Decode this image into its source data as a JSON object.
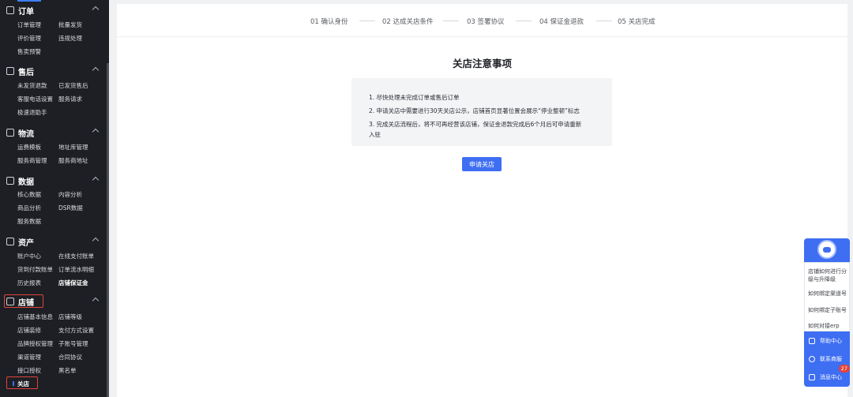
{
  "sidebar": {
    "groups": [
      {
        "title": "订单",
        "icon": "order-icon",
        "items": [
          "订单管理",
          "批量发货",
          "评价管理",
          "违规处理",
          "售卖预警"
        ]
      },
      {
        "title": "售后",
        "icon": "after-sale-icon",
        "items": [
          "未发货退款",
          "已发货售后",
          "客服电话设置",
          "服务请求",
          "极速退助手"
        ]
      },
      {
        "title": "物流",
        "icon": "logistics-icon",
        "items": [
          "运费模板",
          "地址库管理",
          "服务商管理",
          "服务商地址"
        ]
      },
      {
        "title": "数据",
        "icon": "data-icon",
        "items": [
          "核心数据",
          "内容分析",
          "商品分析",
          "DSR数据",
          "服务数据"
        ]
      },
      {
        "title": "资产",
        "icon": "assets-icon",
        "items": [
          "账户中心",
          "在线支付账单",
          "货到付款账单",
          "订单流水明细",
          "历史报表",
          "店铺保证金"
        ]
      },
      {
        "title": "店铺",
        "icon": "shop-icon",
        "items": [
          "店铺基本信息",
          "店铺等级",
          "店铺装修",
          "支付方式设置",
          "品牌授权管理",
          "子账号管理",
          "渠道管理",
          "合同协议",
          "接口授权",
          "黑名单",
          "关店"
        ]
      }
    ]
  },
  "steps": [
    "01 确认身份",
    "02 达成关店条件",
    "03 签署协议",
    "04 保证金退款",
    "05 关店完成"
  ],
  "notice": {
    "title": "关店注意事项",
    "lines": [
      "1. 尽快处理未完成订单或售后订单",
      "2. 申请关店中需要进行30天关店公示，店铺首页显著位置会展示“停业整顿”标志",
      "3. 完成关店流程后，将不可再经营该店铺，保证金退款完成后6个月后可申请重新",
      "入驻"
    ],
    "apply_button": "申请关店"
  },
  "help": {
    "faqs": [
      "店铺如何进行分级与升降级",
      "如何绑定渠道号",
      "如何绑定子账号",
      "如何对接erp"
    ],
    "buttons": [
      "帮助中心",
      "联系商服",
      "消息中心"
    ],
    "badge_count": "27"
  },
  "colors": {
    "accent": "#3e6ef2",
    "highlight": "#e0443a",
    "sidebar_bg": "#1d1f24"
  }
}
